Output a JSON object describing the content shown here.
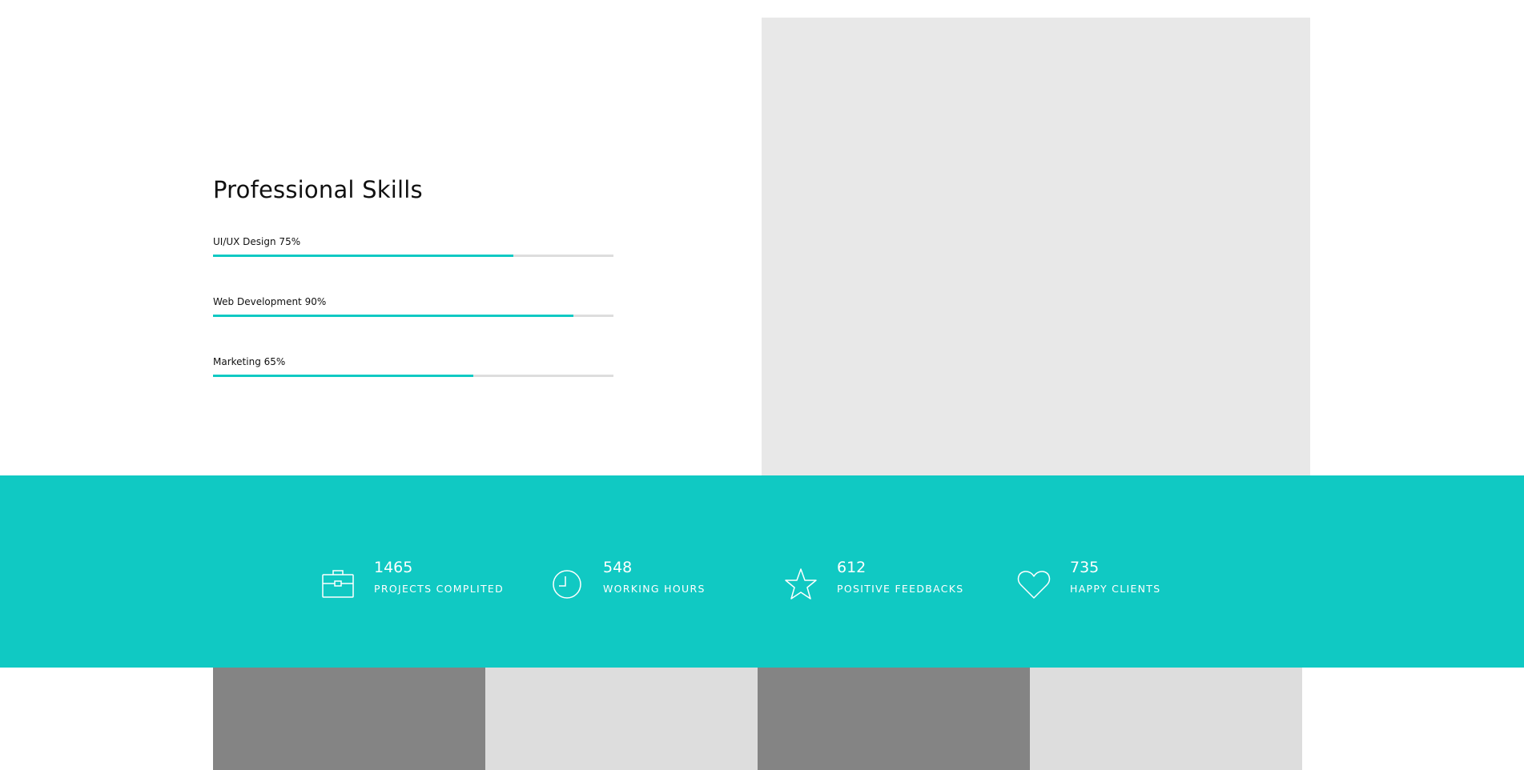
{
  "skills": {
    "title": "Professional Skills",
    "items": [
      {
        "label": "UI/UX Design 75%",
        "percent": 75
      },
      {
        "label": "Web Development 90%",
        "percent": 90
      },
      {
        "label": "Marketing 65%",
        "percent": 65
      }
    ],
    "bar_color": "#10c9c3",
    "track_color": "#dddddd"
  },
  "stats": {
    "background": "#10c9c3",
    "items": [
      {
        "number": "1465",
        "caption": "PROJECTS COMPLITED",
        "icon": "briefcase-icon"
      },
      {
        "number": "548",
        "caption": "WORKING HOURS",
        "icon": "clock-icon"
      },
      {
        "number": "612",
        "caption": "POSITIVE FEEDBACKS",
        "icon": "star-icon"
      },
      {
        "number": "735",
        "caption": "HAPPY CLIENTS",
        "icon": "heart-icon"
      }
    ]
  }
}
